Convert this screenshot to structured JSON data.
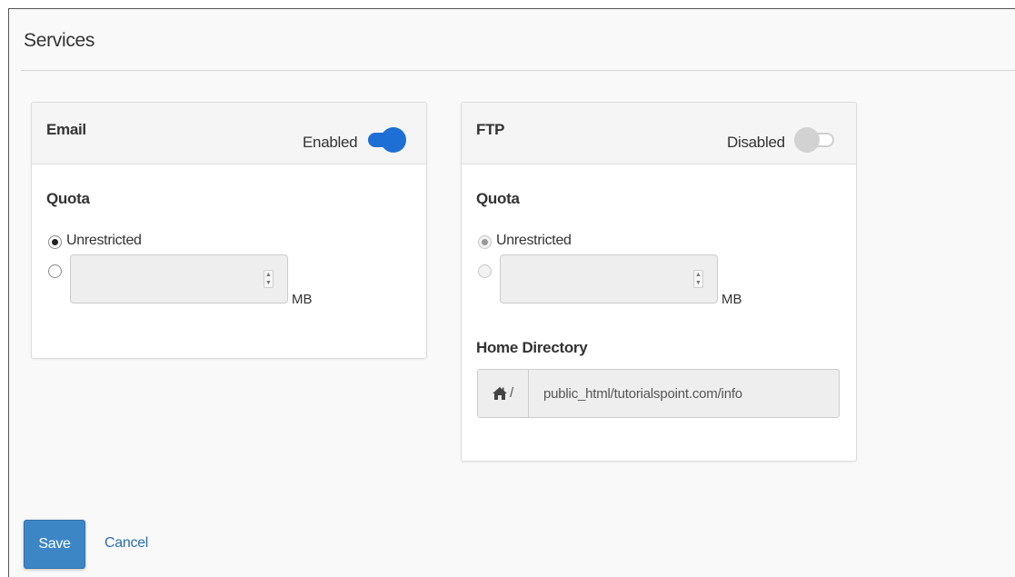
{
  "page": {
    "title": "Services"
  },
  "email": {
    "title": "Email",
    "status": "Enabled",
    "enabled": true,
    "quota_label": "Quota",
    "option_unrestricted": "Unrestricted",
    "unrestricted_selected": true,
    "quota_value": "",
    "unit": "MB"
  },
  "ftp": {
    "title": "FTP",
    "status": "Disabled",
    "enabled": false,
    "quota_label": "Quota",
    "option_unrestricted": "Unrestricted",
    "unrestricted_selected": true,
    "quota_value": "",
    "unit": "MB",
    "home_directory_label": "Home Directory",
    "home_directory_prefix": "/",
    "home_directory_value": "public_html/tutorialspoint.com/info"
  },
  "actions": {
    "save_label": "Save",
    "cancel_label": "Cancel"
  },
  "colors": {
    "accent": "#1d6fd5",
    "save_button": "#3d86c6",
    "link": "#2e6fb0",
    "toggle_off": "#d2d2d2"
  },
  "icons": {
    "home": "home-icon",
    "spinner": "spinner-arrows-icon"
  }
}
